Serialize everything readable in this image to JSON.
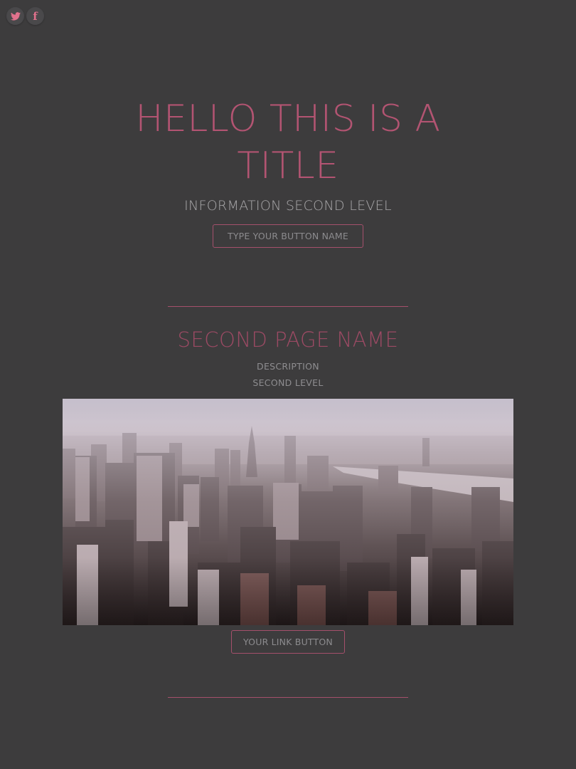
{
  "social": {
    "items": [
      {
        "name": "twitter",
        "icon": "twitter-icon"
      },
      {
        "name": "facebook",
        "icon": "facebook-icon",
        "glyph": "f"
      }
    ]
  },
  "hero": {
    "title_line1": "HELLO THIS IS A",
    "title_line2": "TITLE",
    "subtitle": "INFORMATION SECOND LEVEL",
    "button_label": "TYPE YOUR BUTTON NAME"
  },
  "section": {
    "title": "SECOND PAGE NAME",
    "description_line1": "DESCRIPTION",
    "description_line2": "SECOND LEVEL",
    "link_button_label": "YOUR LINK BUTTON"
  },
  "colors": {
    "background": "#3d3c3d",
    "accent": "#b35472",
    "accent_border": "#a5506c",
    "muted_text": "#a9a8aa"
  }
}
